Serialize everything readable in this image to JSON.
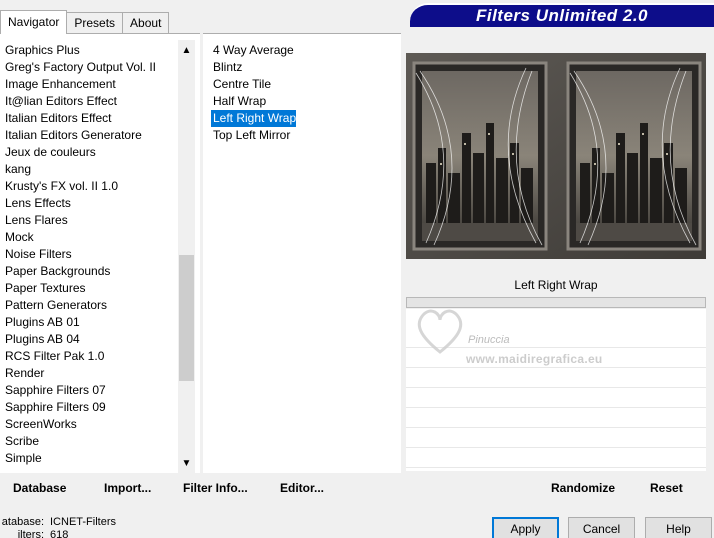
{
  "tabs": [
    {
      "label": "Navigator"
    },
    {
      "label": "Presets"
    },
    {
      "label": "About"
    }
  ],
  "banner": {
    "title": "Filters Unlimited 2.0"
  },
  "categories": [
    "Graphics Plus",
    "Greg's Factory Output Vol. II",
    "Image Enhancement",
    "It@lian Editors Effect",
    "Italian Editors Effect",
    "Italian Editors Generatore",
    "Jeux de couleurs",
    "kang",
    "Krusty's FX vol. II 1.0",
    "Lens Effects",
    "Lens Flares",
    "Mock",
    "Noise Filters",
    "Paper Backgrounds",
    "Paper Textures",
    "Pattern Generators",
    "Plugins AB 01",
    "Plugins AB 04",
    "RCS Filter Pak 1.0",
    "Render",
    "Sapphire Filters 07",
    "Sapphire Filters 09",
    "ScreenWorks",
    "Scribe",
    "Simple"
  ],
  "filters": [
    {
      "label": "4 Way Average",
      "selected": false
    },
    {
      "label": "Blintz",
      "selected": false
    },
    {
      "label": "Centre Tile",
      "selected": false
    },
    {
      "label": "Half Wrap",
      "selected": false
    },
    {
      "label": "Left Right Wrap",
      "selected": true
    },
    {
      "label": "Top Left Mirror",
      "selected": false
    }
  ],
  "preview": {
    "filter_name": "Left Right Wrap"
  },
  "watermark": {
    "name": "Pinuccia",
    "url": "www.maidiregrafica.eu"
  },
  "bottom_links": {
    "database": "Database",
    "import": "Import...",
    "filter_info": "Filter Info...",
    "editor": "Editor...",
    "randomize": "Randomize",
    "reset": "Reset"
  },
  "footer": {
    "database_key": "atabase:",
    "database_val": "ICNET-Filters",
    "filters_key": "ilters:",
    "filters_val": "618"
  },
  "buttons": {
    "apply": "Apply",
    "cancel": "Cancel",
    "help": "Help"
  },
  "scroll": {
    "up_icon": "chevron-up-icon",
    "down_icon": "chevron-down-icon"
  },
  "colors": {
    "banner": "#0d0d8a",
    "selection": "#0078d7"
  }
}
